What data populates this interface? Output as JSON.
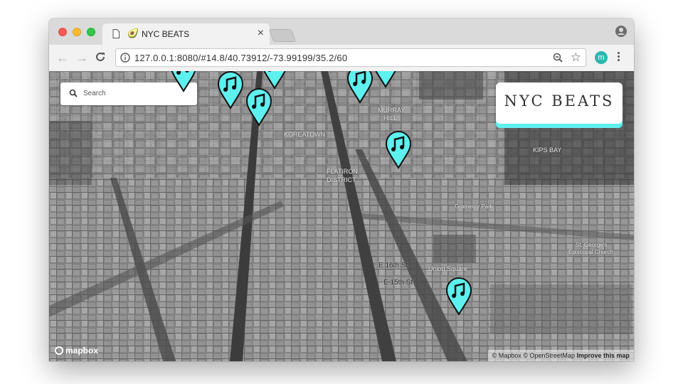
{
  "browser": {
    "tab_title": "NYC BEATS",
    "tab_favicon": "avocado",
    "url": "127.0.0.1:8080/#14.8/40.73912/-73.99199/35.2/60",
    "extension_letter": "m"
  },
  "map": {
    "search_placeholder": "Search",
    "brand_title": "NYC BEATS",
    "accent_color": "#5ef0ef",
    "labels": {
      "koreatown": "KOREATOWN",
      "flatiron": "FLATIRON",
      "district": "DISTRICT",
      "murray": "MURRAY",
      "hill": "HILL",
      "gramercy_park": "Gramercy Park",
      "union_square": "Union Square",
      "e16": "E 16th St",
      "e15": "E 15th St",
      "st_georges_1": "St. George's",
      "st_georges_2": "Episcopal Church",
      "kips_bay": "KIPS BAY"
    },
    "pin_icon": "music-note-icon",
    "mapbox_logo": "mapbox",
    "attribution_copy": "© Mapbox © OpenStreetMap",
    "attribution_improve": "Improve this map"
  }
}
